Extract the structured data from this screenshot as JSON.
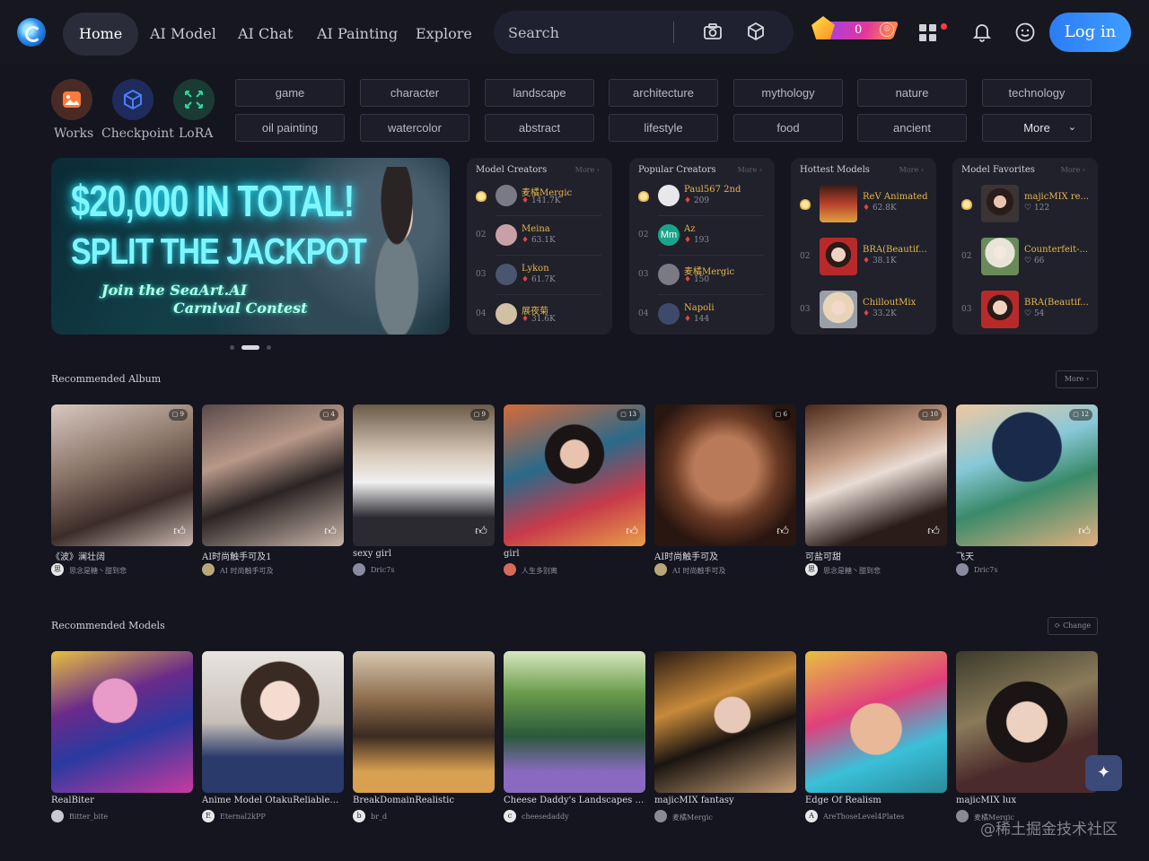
{
  "header": {
    "nav": [
      "Home",
      "AI Model",
      "AI Chat",
      "AI Painting",
      "Explore"
    ],
    "search_placeholder": "Search",
    "coins": "0",
    "coin_badge": "®",
    "login_label": "Log in"
  },
  "types": [
    {
      "label": "Works",
      "icon": "image-icon",
      "color": "#ff7a3a"
    },
    {
      "label": "Checkpoint",
      "icon": "cube-icon",
      "color": "#3a6dff"
    },
    {
      "label": "LoRA",
      "icon": "expand-icon",
      "color": "#2ed6a0"
    }
  ],
  "tags": [
    "game",
    "character",
    "landscape",
    "architecture",
    "mythology",
    "nature",
    "technology",
    "oil painting",
    "watercolor",
    "abstract",
    "lifestyle",
    "food",
    "ancient",
    "More"
  ],
  "banner": {
    "line1": "$20,000 IN TOTAL!",
    "line2": "SPLIT THE JACKPOT",
    "line3": "Join the SeaArt.AI",
    "line4": "Carnival Contest"
  },
  "panels": [
    {
      "title": "Model Creators",
      "more": "More",
      "rows": [
        {
          "rank": "",
          "name": "麦橘Mergic",
          "stat": "141.7K"
        },
        {
          "rank": "02",
          "name": "Meina",
          "stat": "63.1K"
        },
        {
          "rank": "03",
          "name": "Lykon",
          "stat": "61.7K"
        },
        {
          "rank": "04",
          "name": "展夜菊",
          "stat": "31.6K"
        }
      ]
    },
    {
      "title": "Popular Creators",
      "more": "More",
      "rows": [
        {
          "rank": "",
          "name": "Paul567 2nd",
          "stat": "209"
        },
        {
          "rank": "02",
          "name": "Az",
          "stat": "193",
          "avatar_text": "Mm"
        },
        {
          "rank": "03",
          "name": "麦橘Mergic",
          "stat": "150"
        },
        {
          "rank": "04",
          "name": "Napoli",
          "stat": "144"
        }
      ]
    },
    {
      "title": "Hottest Models",
      "more": "More",
      "rows": [
        {
          "rank": "",
          "name": "ReV Animated",
          "stat": "62.8K"
        },
        {
          "rank": "02",
          "name": "BRA(Beautif...",
          "stat": "38.1K"
        },
        {
          "rank": "03",
          "name": "ChilloutMix",
          "stat": "33.2K"
        }
      ]
    },
    {
      "title": "Model Favorites",
      "more": "More",
      "rows": [
        {
          "rank": "",
          "name": "majicMIX re...",
          "stat": "122"
        },
        {
          "rank": "02",
          "name": "Counterfeit-...",
          "stat": "66"
        },
        {
          "rank": "03",
          "name": "BRA(Beautif...",
          "stat": "54"
        }
      ]
    }
  ],
  "album": {
    "title": "Recommended Album",
    "more": "More",
    "cards": [
      {
        "title": "《波》澜壮阔",
        "user": "思念是糖丶甜到悲",
        "count": "9",
        "ava": "思"
      },
      {
        "title": "AI时尚触手可及1",
        "user": "AI 时尚触手可及",
        "count": "4",
        "ava": ""
      },
      {
        "title": "sexy girl",
        "user": "Dric7s",
        "count": "9",
        "ava": ""
      },
      {
        "title": "girl",
        "user": "人生多别离",
        "count": "13",
        "ava": ""
      },
      {
        "title": "AI时尚触手可及",
        "user": "AI 时尚触手可及",
        "count": "6",
        "ava": ""
      },
      {
        "title": "可盐可甜",
        "user": "思念是糖丶甜到悲",
        "count": "10",
        "ava": "思"
      },
      {
        "title": "飞天",
        "user": "Dric7s",
        "count": "12",
        "ava": ""
      }
    ]
  },
  "models": {
    "title": "Recommended Models",
    "change": "Change",
    "cards": [
      {
        "title": "RealBiter",
        "user": "Bitter_bite",
        "ava": ""
      },
      {
        "title": "Anime Model OtakuReliableEn...",
        "user": "Eternal2kPP",
        "ava": "E"
      },
      {
        "title": "BreakDomainRealistic",
        "user": "br_d",
        "ava": "b"
      },
      {
        "title": "Cheese Daddy's Landscapes mix",
        "user": "cheesedaddy",
        "ava": "c"
      },
      {
        "title": "majicMIX fantasy",
        "user": "麦橘Mergic",
        "ava": ""
      },
      {
        "title": "Edge Of Realism",
        "user": "AreThoseLevel4Plates",
        "ava": "A"
      },
      {
        "title": "majicMIX lux",
        "user": "麦橘Mergic",
        "ava": ""
      }
    ]
  },
  "watermark": "@稀土掘金技术社区"
}
